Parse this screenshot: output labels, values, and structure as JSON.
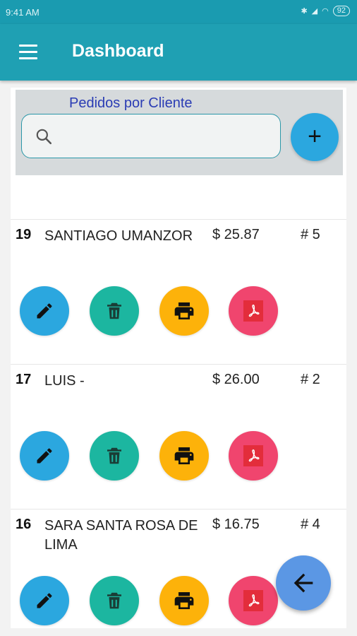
{
  "status_bar": {
    "time": "9:41 AM",
    "battery": "92"
  },
  "app_bar": {
    "title": "Dashboard"
  },
  "search_panel": {
    "title": "Pedidos por  Cliente",
    "search_value": "",
    "add_label": "+"
  },
  "orders": [
    {
      "number": "19",
      "customer": "SANTIAGO  UMANZOR",
      "amount": "$ 25.87",
      "count": "# 5"
    },
    {
      "number": "17",
      "customer": "LUIS   -",
      "amount": "$ 26.00",
      "count": "# 2"
    },
    {
      "number": "16",
      "customer": "SARA SANTA ROSA DE LIMA",
      "amount": "$ 16.75",
      "count": "# 4"
    }
  ],
  "colors": {
    "app_bar": "#1fa0b3",
    "edit": "#2ba7df",
    "delete": "#1cb6a0",
    "print": "#fdb20a",
    "pdf": "#f0456e",
    "back_fab": "#5b97e4"
  },
  "icons": {
    "menu": "hamburger-icon",
    "search": "search-icon",
    "edit": "pencil-icon",
    "delete": "trash-icon",
    "print": "printer-icon",
    "pdf": "pdf-icon",
    "back": "arrow-left-icon"
  }
}
